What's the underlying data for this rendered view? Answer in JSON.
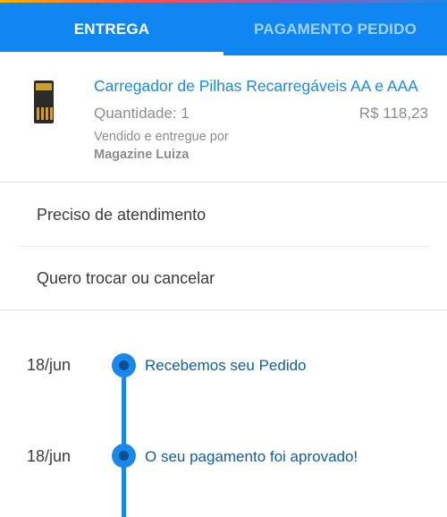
{
  "tabs": [
    {
      "label": "ENTREGA",
      "active": true
    },
    {
      "label": "PAGAMENTO PEDIDO",
      "active": false
    }
  ],
  "colors": {
    "tab_bar": "#0f86f2",
    "accent_blue": "#1a8ae0",
    "timeline_blue": "#1a88e8",
    "timeline_text": "#0d5f9e",
    "muted_text": "#8c8c8c"
  },
  "product": {
    "thumbnail_icon": "battery-charger-icon",
    "name": "Carregador de Pilhas Recarregáveis AA e AAA",
    "quantity": "Quantidade: 1",
    "price": "R$ 118,23",
    "sold_by": "Vendido e entregue por",
    "seller": "Magazine Luiza"
  },
  "actions": [
    {
      "label": "Preciso de atendimento"
    },
    {
      "label": "Quero trocar ou cancelar"
    }
  ],
  "timeline": [
    {
      "date": "18/jun",
      "status": "Recebemos seu Pedido"
    },
    {
      "date": "18/jun",
      "status": "O seu pagamento foi aprovado!"
    }
  ]
}
